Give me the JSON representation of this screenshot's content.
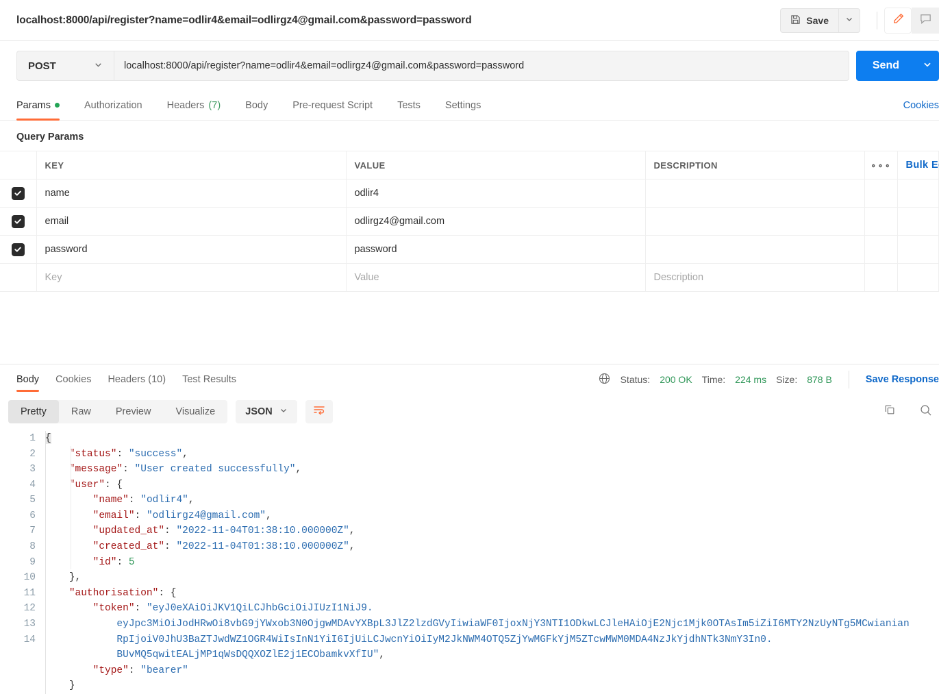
{
  "header": {
    "request_title": "localhost:8000/api/register?name=odlir4&email=odlirgz4@gmail.com&password=password",
    "save_label": "Save",
    "save_icon": "floppy-disk-icon",
    "save_caret_icon": "chevron-down-icon",
    "edit_icon": "pencil-icon",
    "comment_icon": "comment-icon",
    "accent_orange": "#ff6c37"
  },
  "url_row": {
    "method": "POST",
    "method_caret_icon": "chevron-down-icon",
    "url": "localhost:8000/api/register?name=odlir4&email=odlirgz4@gmail.com&password=password",
    "send_label": "Send",
    "send_caret_icon": "chevron-down-icon",
    "send_color": "#0d7ef0"
  },
  "request_tabs": [
    {
      "label": "Params",
      "badge": "dot",
      "active": true
    },
    {
      "label": "Authorization",
      "badge": "",
      "active": false
    },
    {
      "label": "Headers",
      "count": "(7)",
      "active": false
    },
    {
      "label": "Body",
      "badge": "",
      "active": false
    },
    {
      "label": "Pre-request Script",
      "badge": "",
      "active": false
    },
    {
      "label": "Tests",
      "badge": "",
      "active": false
    },
    {
      "label": "Settings",
      "badge": "",
      "active": false
    }
  ],
  "cookies_link": "Cookies",
  "params": {
    "section_label": "Query Params",
    "columns": [
      "KEY",
      "VALUE",
      "DESCRIPTION"
    ],
    "more_icon": "ellipsis-icon",
    "bulk_edit_label": "Bulk Edit",
    "rows": [
      {
        "checked": true,
        "key": "name",
        "value": "odlir4",
        "description": ""
      },
      {
        "checked": true,
        "key": "email",
        "value": "odlirgz4@gmail.com",
        "description": ""
      },
      {
        "checked": true,
        "key": "password",
        "value": "password",
        "description": ""
      }
    ],
    "placeholder_row": {
      "key": "Key",
      "value": "Value",
      "description": "Description"
    }
  },
  "response": {
    "tabs": [
      {
        "label": "Body",
        "active": true
      },
      {
        "label": "Cookies",
        "active": false
      },
      {
        "label": "Headers (10)",
        "active": false
      },
      {
        "label": "Test Results",
        "active": false
      }
    ],
    "globe_icon": "globe-icon",
    "status_label": "Status:",
    "status_value": "200 OK",
    "time_label": "Time:",
    "time_value": "224 ms",
    "size_label": "Size:",
    "size_value": "878 B",
    "save_response_label": "Save Response",
    "viewbar": {
      "modes": [
        {
          "label": "Pretty",
          "active": true
        },
        {
          "label": "Raw",
          "active": false
        },
        {
          "label": "Preview",
          "active": false
        },
        {
          "label": "Visualize",
          "active": false
        }
      ],
      "language": "JSON",
      "language_caret_icon": "chevron-down-icon",
      "wrap_icon": "wrap-lines-icon",
      "copy_icon": "copy-icon",
      "search_icon": "search-icon"
    },
    "body_lines": [
      {
        "n": "1",
        "segments": [
          {
            "t": "{",
            "c": "p"
          }
        ]
      },
      {
        "n": "2",
        "indent": 4,
        "segments": [
          {
            "t": "\"status\"",
            "c": "k"
          },
          {
            "t": ": ",
            "c": "p"
          },
          {
            "t": "\"success\"",
            "c": "s"
          },
          {
            "t": ",",
            "c": "p"
          }
        ]
      },
      {
        "n": "3",
        "indent": 4,
        "segments": [
          {
            "t": "\"message\"",
            "c": "k"
          },
          {
            "t": ": ",
            "c": "p"
          },
          {
            "t": "\"User created successfully\"",
            "c": "s"
          },
          {
            "t": ",",
            "c": "p"
          }
        ]
      },
      {
        "n": "4",
        "indent": 4,
        "segments": [
          {
            "t": "\"user\"",
            "c": "k"
          },
          {
            "t": ": {",
            "c": "p"
          }
        ]
      },
      {
        "n": "5",
        "indent": 8,
        "segments": [
          {
            "t": "\"name\"",
            "c": "k"
          },
          {
            "t": ": ",
            "c": "p"
          },
          {
            "t": "\"odlir4\"",
            "c": "s"
          },
          {
            "t": ",",
            "c": "p"
          }
        ]
      },
      {
        "n": "6",
        "indent": 8,
        "segments": [
          {
            "t": "\"email\"",
            "c": "k"
          },
          {
            "t": ": ",
            "c": "p"
          },
          {
            "t": "\"odlirgz4@gmail.com\"",
            "c": "s"
          },
          {
            "t": ",",
            "c": "p"
          }
        ]
      },
      {
        "n": "7",
        "indent": 8,
        "segments": [
          {
            "t": "\"updated_at\"",
            "c": "k"
          },
          {
            "t": ": ",
            "c": "p"
          },
          {
            "t": "\"2022-11-04T01:38:10.000000Z\"",
            "c": "s"
          },
          {
            "t": ",",
            "c": "p"
          }
        ]
      },
      {
        "n": "8",
        "indent": 8,
        "segments": [
          {
            "t": "\"created_at\"",
            "c": "k"
          },
          {
            "t": ": ",
            "c": "p"
          },
          {
            "t": "\"2022-11-04T01:38:10.000000Z\"",
            "c": "s"
          },
          {
            "t": ",",
            "c": "p"
          }
        ]
      },
      {
        "n": "9",
        "indent": 8,
        "segments": [
          {
            "t": "\"id\"",
            "c": "k"
          },
          {
            "t": ": ",
            "c": "p"
          },
          {
            "t": "5",
            "c": "n"
          }
        ]
      },
      {
        "n": "10",
        "indent": 4,
        "segments": [
          {
            "t": "},",
            "c": "p"
          }
        ]
      },
      {
        "n": "11",
        "indent": 4,
        "segments": [
          {
            "t": "\"authorisation\"",
            "c": "k"
          },
          {
            "t": ": {",
            "c": "p"
          }
        ]
      },
      {
        "n": "12",
        "indent": 8,
        "segments": [
          {
            "t": "\"token\"",
            "c": "k"
          },
          {
            "t": ": ",
            "c": "p"
          },
          {
            "t": "\"eyJ0eXAiOiJKV1QiLCJhbGciOiJIUzI1NiJ9.",
            "c": "s"
          }
        ]
      },
      {
        "n": "",
        "indent": 12,
        "segments": [
          {
            "t": "eyJpc3MiOiJodHRwOi8vbG9jYWxob3N0OjgwMDAvYXBpL3JlZ2lzdGVyIiwiaWF0IjoxNjY3NTI1ODkwLCJleHAiOjE2Njc1Mjk0OTAsIm5iZiI6MTY2NzUyNTg5MCwianian",
            "c": "s"
          }
        ]
      },
      {
        "n": "",
        "indent": 12,
        "segments": [
          {
            "t": "RpIjoiV0JhU3BaZTJwdWZ1OGR4WiIsInN1YiI6IjUiLCJwcnYiOiIyM2JkNWM4OTQ5ZjYwMGFkYjM5ZTcwMWM0MDA4NzJkYjdhNTk3NmY3In0.",
            "c": "s"
          }
        ]
      },
      {
        "n": "",
        "indent": 12,
        "segments": [
          {
            "t": "BUvMQ5qwitEALjMP1qWsDQQXOZlE2j1ECObamkvXfIU\"",
            "c": "s"
          },
          {
            "t": ",",
            "c": "p"
          }
        ]
      },
      {
        "n": "13",
        "indent": 8,
        "segments": [
          {
            "t": "\"type\"",
            "c": "k"
          },
          {
            "t": ": ",
            "c": "p"
          },
          {
            "t": "\"bearer\"",
            "c": "s"
          }
        ]
      },
      {
        "n": "14",
        "indent": 4,
        "segments": [
          {
            "t": "}",
            "c": "p"
          }
        ]
      }
    ]
  }
}
